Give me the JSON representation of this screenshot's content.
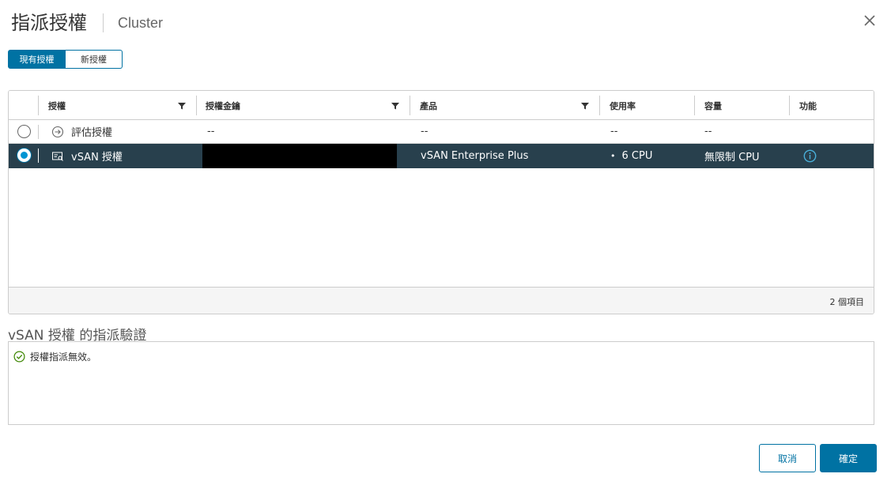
{
  "dialog": {
    "title": "指派授權",
    "subtitle": "Cluster"
  },
  "tabs": [
    {
      "label": "現有授權",
      "active": true
    },
    {
      "label": "新授權",
      "active": false
    }
  ],
  "table": {
    "columns": [
      "授權",
      "授權金鑰",
      "產品",
      "使用率",
      "容量",
      "功能"
    ],
    "rows": [
      {
        "selected": false,
        "icon": "arrow-circle-icon",
        "name": "評估授權",
        "key": "--",
        "product": "--",
        "usage": "--",
        "capacity": "--",
        "feature": ""
      },
      {
        "selected": true,
        "icon": "license-icon",
        "name": "vSAN 授權",
        "key": "",
        "product": "vSAN Enterprise Plus",
        "usage": "6 CPU",
        "capacity": "無限制 CPU",
        "feature": "info-icon"
      }
    ],
    "footer_count": "2 個項目"
  },
  "validation": {
    "title": "vSAN 授權 的指派驗證",
    "message": "授權指派無效。",
    "icon": "check-circle-icon"
  },
  "actions": {
    "cancel": "取消",
    "ok": "確定"
  },
  "colors": {
    "primary": "#0072a3",
    "selected_row": "#28404d",
    "success": "#3c8500",
    "info": "#0095d3"
  }
}
